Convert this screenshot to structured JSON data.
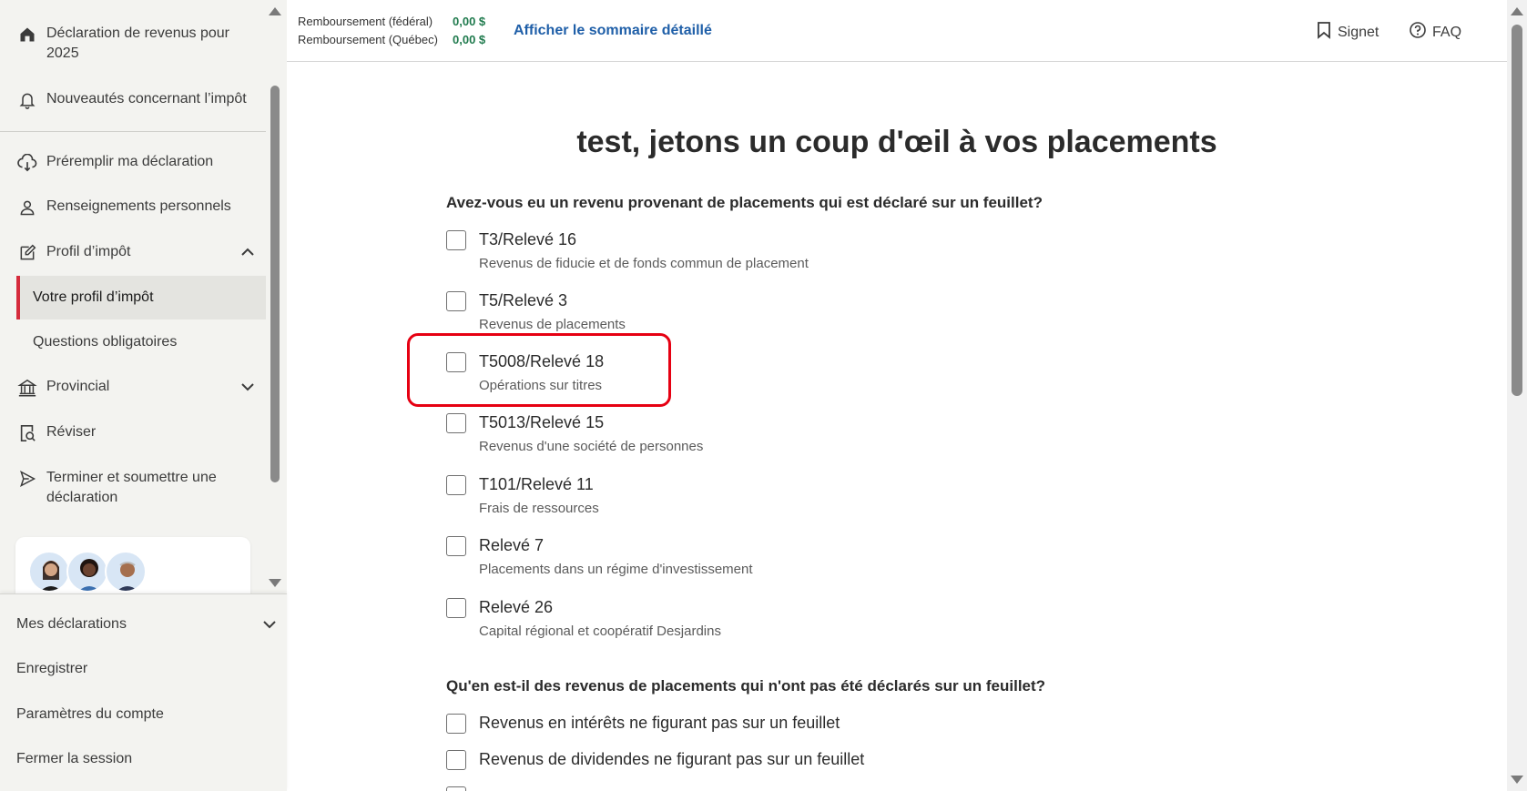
{
  "sidebar": {
    "top_items": [
      {
        "label": "Déclaration de revenus pour 2025",
        "icon": "home-icon"
      },
      {
        "label": "Nouveautés concernant l’impôt",
        "icon": "bell-icon"
      }
    ],
    "items": [
      {
        "label": "Préremplir ma déclaration",
        "icon": "cloud-download-icon"
      },
      {
        "label": "Renseignements personnels",
        "icon": "person-icon"
      },
      {
        "label": "Profil d’impôt",
        "icon": "edit-icon",
        "expanded": true
      },
      {
        "label": "Provincial",
        "icon": "bank-icon",
        "expanded": false
      },
      {
        "label": "Réviser",
        "icon": "document-search-icon"
      },
      {
        "label": "Terminer et soumettre une déclaration",
        "icon": "send-icon"
      }
    ],
    "sub_items": [
      {
        "label": "Votre profil d’impôt",
        "active": true
      },
      {
        "label": "Questions obligatoires",
        "active": false
      }
    ],
    "bottom_items": [
      {
        "label": "Mes déclarations"
      },
      {
        "label": "Enregistrer"
      },
      {
        "label": "Paramètres du compte"
      },
      {
        "label": "Fermer la session"
      }
    ]
  },
  "header": {
    "refund_federal_label": "Remboursement (fédéral)",
    "refund_federal_value": "0,00 $",
    "refund_quebec_label": "Remboursement (Québec)",
    "refund_quebec_value": "0,00 $",
    "summary_link": "Afficher le sommaire détaillé",
    "bookmark_label": "Signet",
    "faq_label": "FAQ"
  },
  "main": {
    "title": "test, jetons un coup d'œil à vos placements",
    "question1": "Avez-vous eu un revenu provenant de placements qui est déclaré sur un feuillet?",
    "options1": [
      {
        "title": "T3/Relevé 16",
        "desc": "Revenus de fiducie et de fonds commun de placement",
        "checked": false
      },
      {
        "title": "T5/Relevé 3",
        "desc": "Revenus de placements",
        "checked": false
      },
      {
        "title": "T5008/Relevé 18",
        "desc": "Opérations sur titres",
        "checked": false
      },
      {
        "title": "T5013/Relevé 15",
        "desc": "Revenus d'une société de personnes",
        "checked": false
      },
      {
        "title": "T101/Relevé 11",
        "desc": "Frais de ressources",
        "checked": false
      },
      {
        "title": "Relevé 7",
        "desc": "Placements dans un régime d'investissement",
        "checked": false
      },
      {
        "title": "Relevé 26",
        "desc": "Capital régional et coopératif Desjardins",
        "checked": false
      }
    ],
    "question2": "Qu'en est-il des revenus de placements qui n'ont pas été déclarés sur un feuillet?",
    "options2": [
      {
        "title": "Revenus en intérêts ne figurant pas sur un feuillet",
        "checked": false
      },
      {
        "title": "Revenus de dividendes ne figurant pas sur un feuillet",
        "checked": false
      }
    ]
  },
  "colors": {
    "accent_red": "#d52b3c",
    "link_blue": "#1f5fa8",
    "refund_green": "#1f7a4d",
    "highlight_red": "#e60012"
  }
}
